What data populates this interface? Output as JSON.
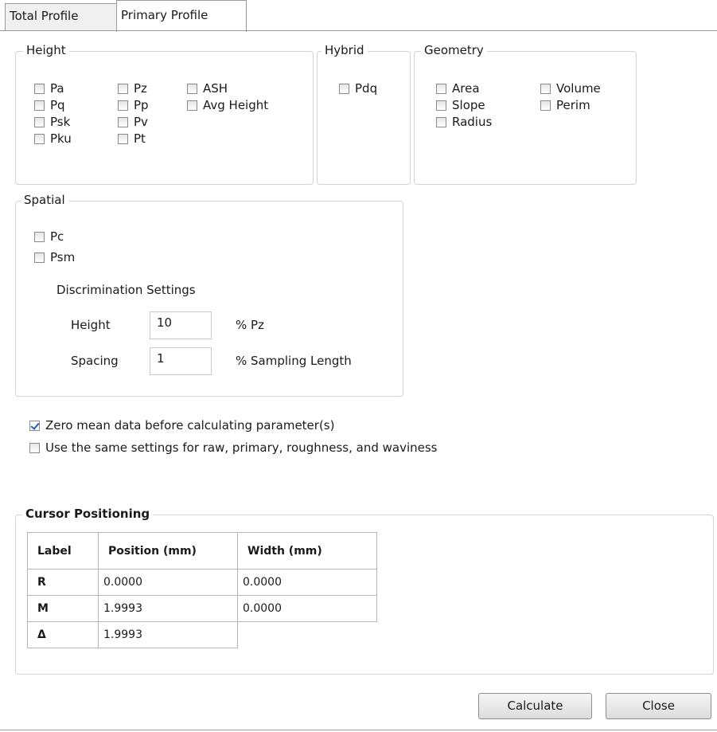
{
  "tabs": [
    {
      "label": "Total Profile",
      "active": false
    },
    {
      "label": "Primary Profile",
      "active": true
    }
  ],
  "height_group": {
    "title": "Height",
    "checkboxes": [
      {
        "label": "Pa",
        "checked": false
      },
      {
        "label": "Pq",
        "checked": false
      },
      {
        "label": "Psk",
        "checked": false
      },
      {
        "label": "Pku",
        "checked": false
      },
      {
        "label": "Pz",
        "checked": false
      },
      {
        "label": "Pp",
        "checked": false
      },
      {
        "label": "Pv",
        "checked": false
      },
      {
        "label": "Pt",
        "checked": false
      },
      {
        "label": "ASH",
        "checked": false
      },
      {
        "label": "Avg Height",
        "checked": false
      }
    ]
  },
  "hybrid_group": {
    "title": "Hybrid",
    "checkboxes": [
      {
        "label": "Pdq",
        "checked": false
      }
    ]
  },
  "geometry_group": {
    "title": "Geometry",
    "checkboxes": [
      {
        "label": "Area",
        "checked": false
      },
      {
        "label": "Slope",
        "checked": false
      },
      {
        "label": "Radius",
        "checked": false
      },
      {
        "label": "Volume",
        "checked": false
      },
      {
        "label": "Perim",
        "checked": false
      }
    ]
  },
  "spatial_group": {
    "title": "Spatial",
    "checkboxes": [
      {
        "label": "Pc",
        "checked": false
      },
      {
        "label": "Psm",
        "checked": false
      }
    ],
    "discrimination_title": "Discrimination Settings",
    "height_label": "Height",
    "height_value": "10",
    "height_unit": "% Pz",
    "spacing_label": "Spacing",
    "spacing_value": "1",
    "spacing_unit": "% Sampling Length"
  },
  "options": {
    "zero_mean": {
      "label": "Zero mean data before calculating parameter(s)",
      "checked": true
    },
    "same_settings": {
      "label": "Use the same settings for raw, primary, roughness, and waviness",
      "checked": false
    }
  },
  "cursor": {
    "title": "Cursor Positioning",
    "headers": [
      "Label",
      "Position (mm)",
      "Width (mm)"
    ],
    "rows": [
      {
        "label": "R",
        "position": "0.0000",
        "width": "0.0000"
      },
      {
        "label": "M",
        "position": "1.9993",
        "width": "0.0000"
      },
      {
        "label": "Δ",
        "position": "1.9993"
      }
    ]
  },
  "buttons": {
    "calculate": "Calculate",
    "close": "Close"
  },
  "colors": {
    "check": "#1f5fb5",
    "group_border": "#d4d4d4"
  }
}
